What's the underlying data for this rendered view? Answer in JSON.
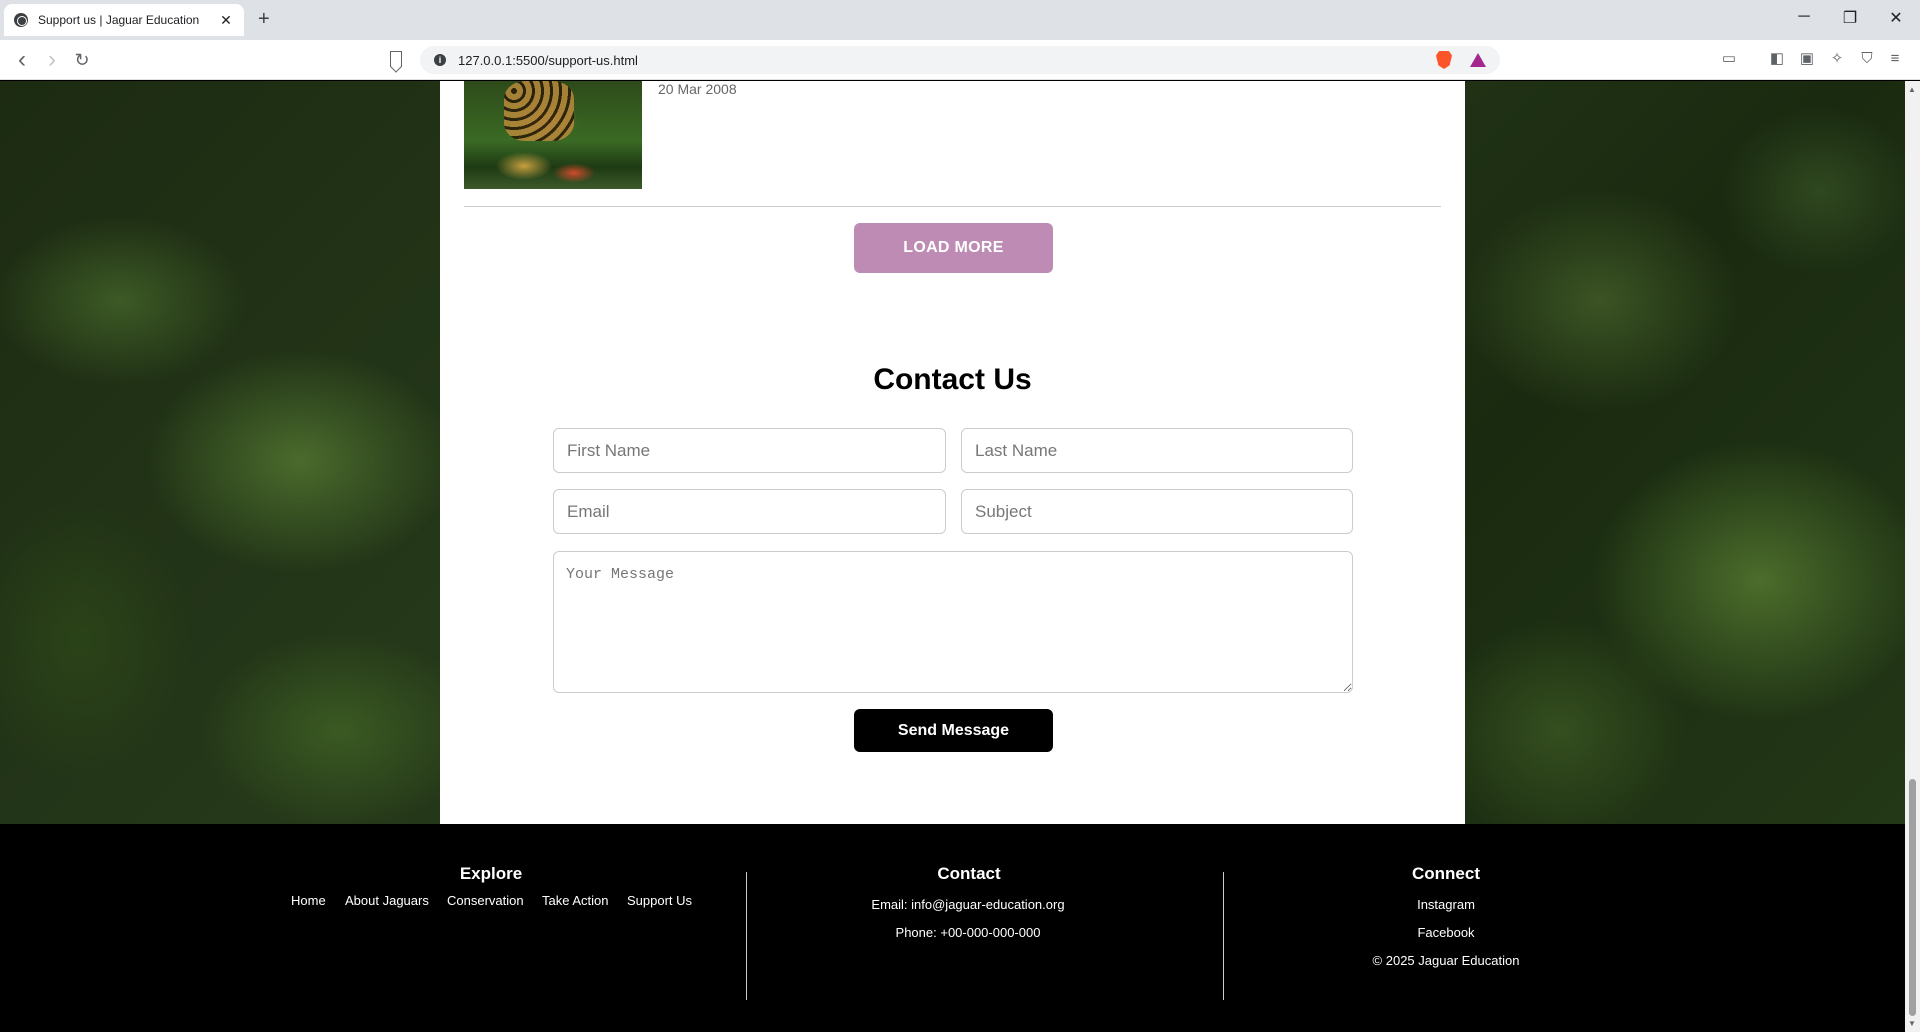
{
  "browser": {
    "tab_title": "Support us | Jaguar Education",
    "new_tab_symbol": "+",
    "close_symbol": "✕",
    "url": "127.0.0.1:5500/support-us.html",
    "window_controls": {
      "minimize": "─",
      "restore": "❐",
      "close": "✕"
    },
    "nav": {
      "back": "‹",
      "forward": "›",
      "reload": "↻"
    },
    "info_symbol": "i"
  },
  "news": {
    "date": "20 Mar 2008",
    "thumbnail_icon": "jaguar-photo"
  },
  "load_more_label": "LOAD MORE",
  "contact": {
    "title": "Contact Us",
    "first_name_placeholder": "First Name",
    "last_name_placeholder": "Last Name",
    "email_placeholder": "Email",
    "subject_placeholder": "Subject",
    "message_placeholder": "Your Message",
    "send_label": "Send Message"
  },
  "footer": {
    "explore": {
      "title": "Explore",
      "links": [
        "Home",
        "About Jaguars",
        "Conservation",
        "Take Action",
        "Support Us"
      ]
    },
    "contact": {
      "title": "Contact",
      "email": "Email:  info@jaguar-education.org",
      "phone": "Phone: +00-000-000-000"
    },
    "connect": {
      "title": "Connect",
      "instagram": "Instagram",
      "facebook": "Facebook",
      "copyright": "© 2025 Jaguar Education"
    }
  },
  "colors": {
    "load_more_bg": "#bd8bb3",
    "send_bg": "#000000",
    "footer_bg": "#000000"
  }
}
